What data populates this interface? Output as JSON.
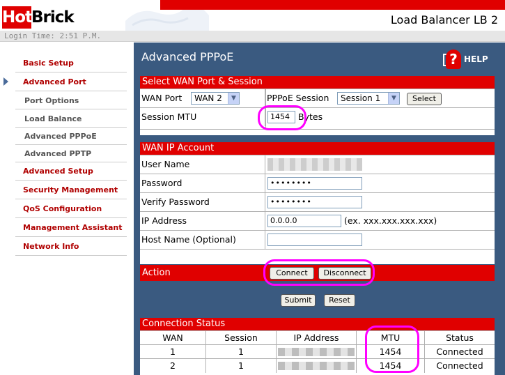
{
  "header": {
    "logo_hot": "Hot",
    "logo_brick": "Brick",
    "product": "Load Balancer LB 2",
    "login_time": "Login Time: 2:51 P.M."
  },
  "sidebar": {
    "items": [
      {
        "label": "Basic Setup"
      },
      {
        "label": "Advanced Port"
      },
      {
        "label": "Port Options"
      },
      {
        "label": "Load Balance"
      },
      {
        "label": "Advanced PPPoE"
      },
      {
        "label": "Advanced PPTP"
      },
      {
        "label": "Advanced Setup"
      },
      {
        "label": "Security Management"
      },
      {
        "label": "QoS Configuration"
      },
      {
        "label": "Management Assistant"
      },
      {
        "label": "Network Info"
      }
    ]
  },
  "main": {
    "title": "Advanced PPPoE",
    "help": "HELP",
    "help_icon": "?",
    "section1": {
      "title": "Select WAN Port & Session",
      "wan_port_label": "WAN Port",
      "wan_port_value": "WAN 2",
      "pppoe_session_label": "PPPoE Session",
      "pppoe_session_value": "Session 1",
      "select_button": "Select",
      "session_mtu_label": "Session MTU",
      "session_mtu_value": "1454",
      "bytes": "Bytes"
    },
    "section2": {
      "title": "WAN IP Account",
      "user_name_label": "User Name",
      "password_label": "Password",
      "password_value": "••••••••",
      "verify_password_label": "Verify Password",
      "verify_password_value": "••••••••",
      "ip_address_label": "IP Address",
      "ip_address_value": "0.0.0.0",
      "ip_hint": "(ex. xxx.xxx.xxx.xxx)",
      "host_name_label": "Host Name (Optional)"
    },
    "action": {
      "label": "Action",
      "connect": "Connect",
      "disconnect": "Disconnect",
      "submit": "Submit",
      "reset": "Reset"
    },
    "status": {
      "title": "Connection Status",
      "columns": [
        "WAN",
        "Session",
        "IP Address",
        "MTU",
        "Status"
      ],
      "rows": [
        {
          "wan": "1",
          "session": "1",
          "mtu": "1454",
          "status": "Connected"
        },
        {
          "wan": "2",
          "session": "1",
          "mtu": "1454",
          "status": "Connected"
        }
      ]
    }
  },
  "colors": {
    "brand_red": "#e00000",
    "main_bg": "#3a5a80",
    "highlight": "#ff00ff",
    "nav_text": "#b00000"
  }
}
